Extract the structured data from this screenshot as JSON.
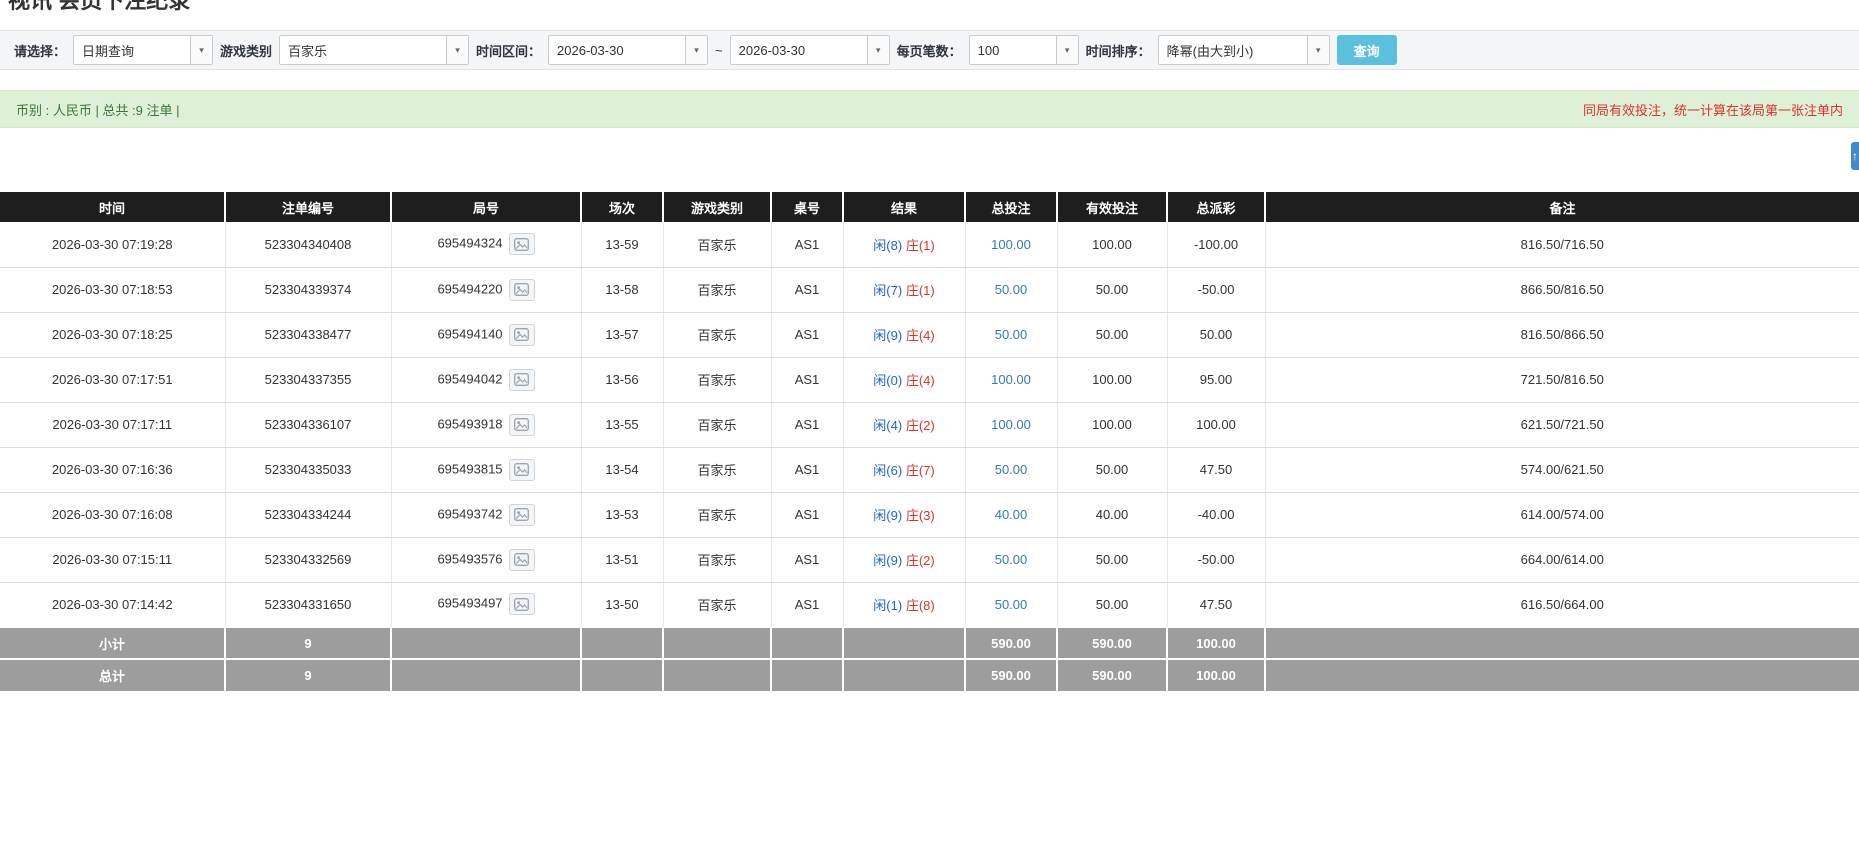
{
  "page": {
    "title": "视讯 会员下注纪录"
  },
  "icons": {
    "caret": "▾",
    "scroll_top": "↑",
    "round_media_icon": "picture"
  },
  "colors": {
    "header-bg": "#1e1e1e",
    "footer-bg": "#9d9d9d",
    "link-blue": "#337ab7",
    "player-blue": "#2163cb",
    "banker-red": "#d9342b",
    "negative-red": "#e8251f",
    "success-bg": "#dff0d8",
    "success-border": "#d6e9c6",
    "success-text": "#3c763d",
    "notice-red": "#d9342b",
    "accent-blue": "#5bc0de",
    "scrolltop-blue": "#428bca"
  },
  "filters": {
    "select_label": "请选择：",
    "select_value": "日期查询",
    "game_label": "游戏类别",
    "game_value": "百家乐",
    "range_label": "时间区间：",
    "date_from": "2026-03-30",
    "range_separator": "~",
    "date_to": "2026-03-30",
    "per_page_label": "每页笔数：",
    "per_page_value": "100",
    "sort_label": "时间排序：",
    "sort_value": "降幂(由大到小)",
    "search_button": "查询"
  },
  "summary": {
    "left": "币别 : 人民币 | 总共 :9 注单 |",
    "right": "同局有效投注，统一计算在该局第一张注单内"
  },
  "table": {
    "headers": [
      "时间",
      "注单编号",
      "局号",
      "场次",
      "游戏类别",
      "桌号",
      "结果",
      "总投注",
      "有效投注",
      "总派彩",
      "备注"
    ],
    "rows": [
      {
        "time": "2026-03-30 07:19:28",
        "bet_id": "523304340408",
        "round_id": "695494324",
        "session": "13-59",
        "game": "百家乐",
        "table_no": "AS1",
        "result_player": "闲(8)",
        "result_banker": "庄(1)",
        "total_bet": "100.00",
        "valid_bet": "100.00",
        "payout": "-100.00",
        "note": "816.50/716.50"
      },
      {
        "time": "2026-03-30 07:18:53",
        "bet_id": "523304339374",
        "round_id": "695494220",
        "session": "13-58",
        "game": "百家乐",
        "table_no": "AS1",
        "result_player": "闲(7)",
        "result_banker": "庄(1)",
        "total_bet": "50.00",
        "valid_bet": "50.00",
        "payout": "-50.00",
        "note": "866.50/816.50"
      },
      {
        "time": "2026-03-30 07:18:25",
        "bet_id": "523304338477",
        "round_id": "695494140",
        "session": "13-57",
        "game": "百家乐",
        "table_no": "AS1",
        "result_player": "闲(9)",
        "result_banker": "庄(4)",
        "total_bet": "50.00",
        "valid_bet": "50.00",
        "payout": "50.00",
        "note": "816.50/866.50"
      },
      {
        "time": "2026-03-30 07:17:51",
        "bet_id": "523304337355",
        "round_id": "695494042",
        "session": "13-56",
        "game": "百家乐",
        "table_no": "AS1",
        "result_player": "闲(0)",
        "result_banker": "庄(4)",
        "total_bet": "100.00",
        "valid_bet": "100.00",
        "payout": "95.00",
        "note": "721.50/816.50"
      },
      {
        "time": "2026-03-30 07:17:11",
        "bet_id": "523304336107",
        "round_id": "695493918",
        "session": "13-55",
        "game": "百家乐",
        "table_no": "AS1",
        "result_player": "闲(4)",
        "result_banker": "庄(2)",
        "total_bet": "100.00",
        "valid_bet": "100.00",
        "payout": "100.00",
        "note": "621.50/721.50"
      },
      {
        "time": "2026-03-30 07:16:36",
        "bet_id": "523304335033",
        "round_id": "695493815",
        "session": "13-54",
        "game": "百家乐",
        "table_no": "AS1",
        "result_player": "闲(6)",
        "result_banker": "庄(7)",
        "total_bet": "50.00",
        "valid_bet": "50.00",
        "payout": "47.50",
        "note": "574.00/621.50"
      },
      {
        "time": "2026-03-30 07:16:08",
        "bet_id": "523304334244",
        "round_id": "695493742",
        "session": "13-53",
        "game": "百家乐",
        "table_no": "AS1",
        "result_player": "闲(9)",
        "result_banker": "庄(3)",
        "total_bet": "40.00",
        "valid_bet": "40.00",
        "payout": "-40.00",
        "note": "614.00/574.00"
      },
      {
        "time": "2026-03-30 07:15:11",
        "bet_id": "523304332569",
        "round_id": "695493576",
        "session": "13-51",
        "game": "百家乐",
        "table_no": "AS1",
        "result_player": "闲(9)",
        "result_banker": "庄(2)",
        "total_bet": "50.00",
        "valid_bet": "50.00",
        "payout": "-50.00",
        "note": "664.00/614.00"
      },
      {
        "time": "2026-03-30 07:14:42",
        "bet_id": "523304331650",
        "round_id": "695493497",
        "session": "13-50",
        "game": "百家乐",
        "table_no": "AS1",
        "result_player": "闲(1)",
        "result_banker": "庄(8)",
        "total_bet": "50.00",
        "valid_bet": "50.00",
        "payout": "47.50",
        "note": "616.50/664.00"
      }
    ],
    "subtotal": {
      "label": "小计",
      "count": "9",
      "total_bet": "590.00",
      "valid_bet": "590.00",
      "payout": "100.00"
    },
    "total": {
      "label": "总计",
      "count": "9",
      "total_bet": "590.00",
      "valid_bet": "590.00",
      "payout": "100.00"
    }
  }
}
